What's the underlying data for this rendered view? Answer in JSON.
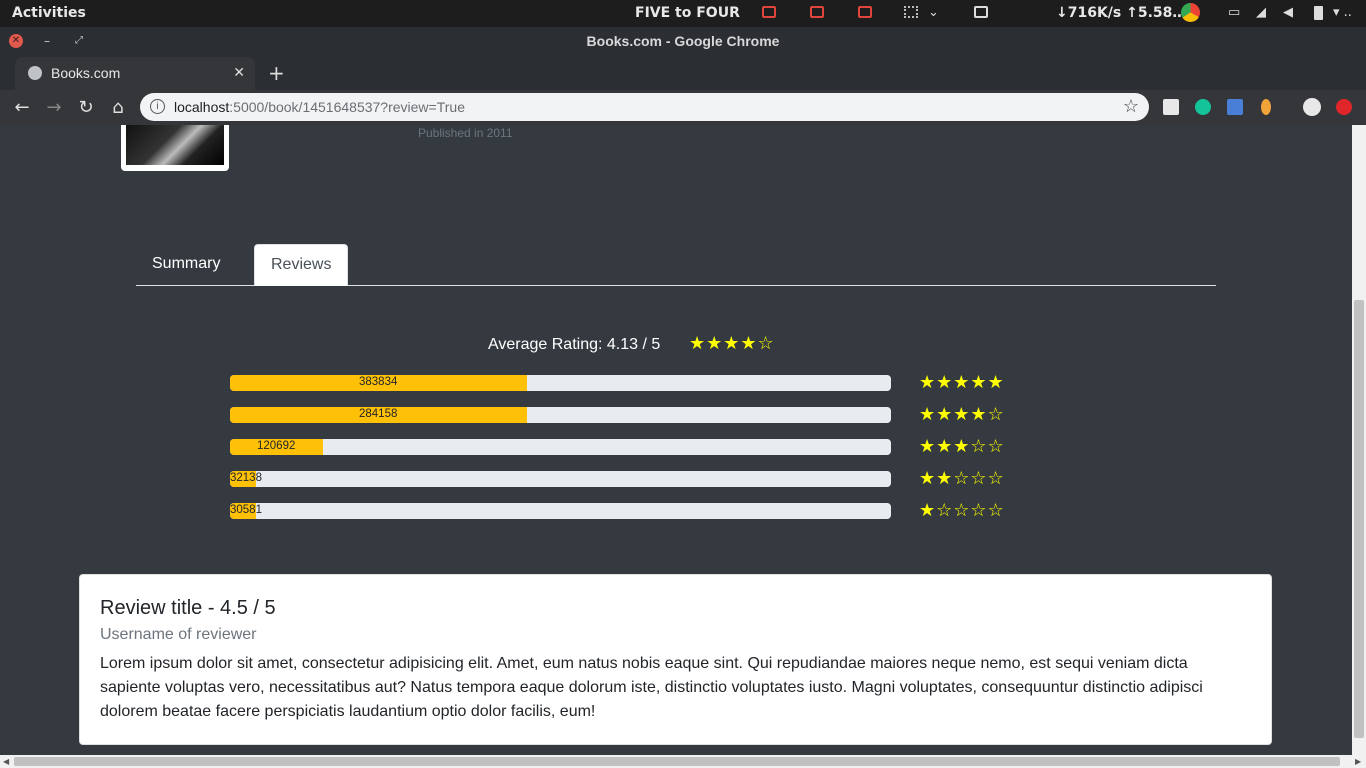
{
  "os": {
    "activities": "Activities",
    "clock": "FIVE to FOUR",
    "netspeed": "↓716K/s ↑5.58…"
  },
  "window": {
    "title": "Books.com - Google Chrome"
  },
  "browser": {
    "tab_label": "Books.com",
    "url_host": "localhost",
    "url_path": ":5000/book/1451648537?review=True"
  },
  "book": {
    "published": "Published in 2011"
  },
  "tabs": {
    "summary": "Summary",
    "reviews": "Reviews"
  },
  "rating": {
    "average_label": "Average Rating: 4.13 / 5",
    "average_value": 4.13,
    "average_stars": "★★★★☆",
    "bars": [
      {
        "count": "383834",
        "fill_pct": 45,
        "stars": "★★★★★"
      },
      {
        "count": "284158",
        "fill_pct": 45,
        "stars": "★★★★☆"
      },
      {
        "count": "120692",
        "fill_pct": 14,
        "stars": "★★★☆☆"
      },
      {
        "count": "32138",
        "fill_pct": 4,
        "stars": "★★☆☆☆"
      },
      {
        "count": "30581",
        "fill_pct": 4,
        "stars": "★☆☆☆☆"
      }
    ]
  },
  "review": {
    "title": "Review title - 4.5 / 5",
    "username": "Username of reviewer",
    "body": "Lorem ipsum dolor sit amet, consectetur adipisicing elit. Amet, eum natus nobis eaque sint. Qui repudiandae maiores neque nemo, est sequi veniam dicta sapiente voluptas vero, necessitatibus aut? Natus tempora eaque dolorum iste, distinctio voluptates iusto. Magni voluptates, consequuntur distinctio adipisci dolorem beatae facere perspiciatis laudantium optio dolor facilis, eum!"
  },
  "colors": {
    "page_bg": "#343a40",
    "star": "#ffff00",
    "bar_fill": "#ffc107",
    "bar_track": "#e9ecef"
  }
}
